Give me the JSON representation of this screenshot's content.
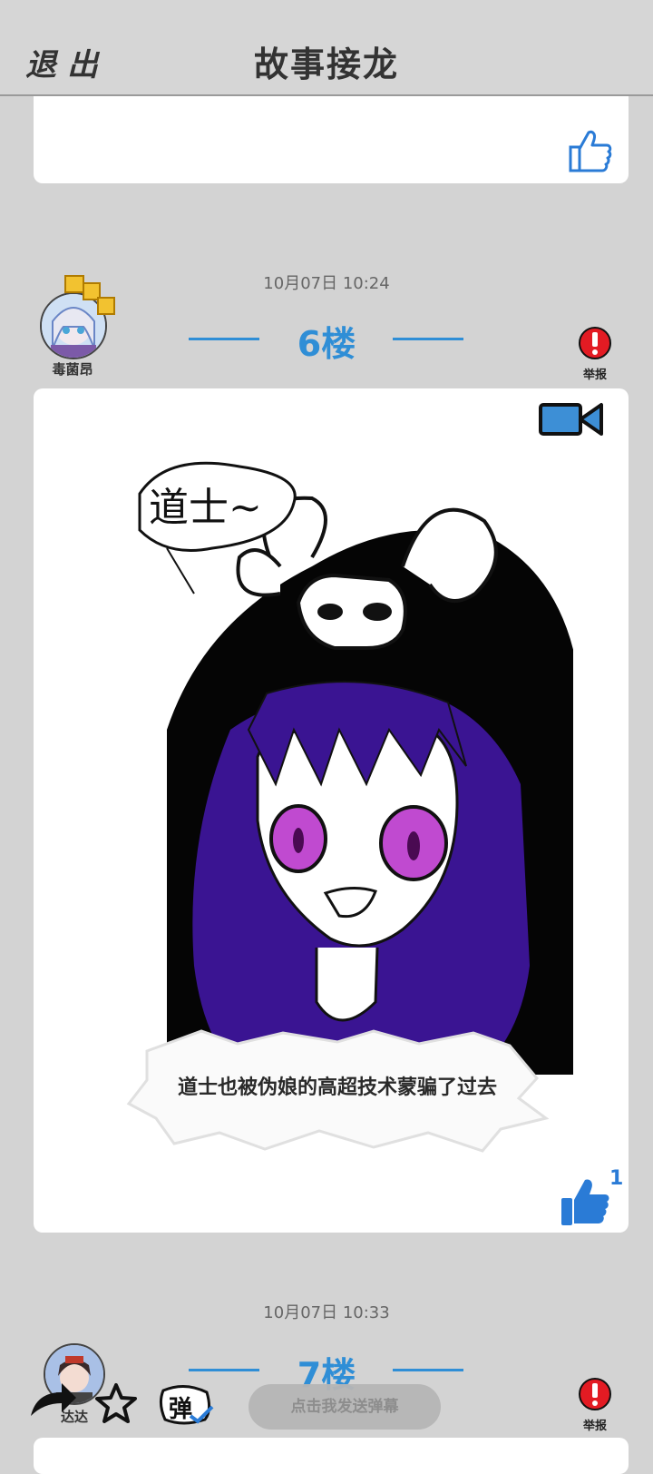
{
  "header": {
    "exit_label": "退出",
    "title": "故事接龙"
  },
  "posts": [
    {
      "timestamp": "10月07日  10:24",
      "floor_label": "6楼",
      "username": "毒菌昂",
      "report_label": "举报",
      "caption": "道士也被伪娘的高超技术蒙骗了过去",
      "drawing_text": "道士~",
      "like_count": "1"
    },
    {
      "timestamp": "10月07日  10:33",
      "floor_label": "7楼",
      "username": "达达",
      "report_label": "举报"
    }
  ],
  "bottom_bar": {
    "danmaku_placeholder": "点击我发送弹幕",
    "danmaku_toggle_label": "弹"
  },
  "colors": {
    "accent": "#2f8ed6",
    "report_red": "#e31b23",
    "like_blue": "#2a7bd6",
    "background": "#d3d3d3"
  },
  "icons": [
    "thumbs-up-outline-icon",
    "thumbs-up-filled-icon",
    "video-camera-icon",
    "report-alert-icon",
    "star-icon",
    "danmaku-toggle-icon",
    "share-arrow-icon"
  ]
}
